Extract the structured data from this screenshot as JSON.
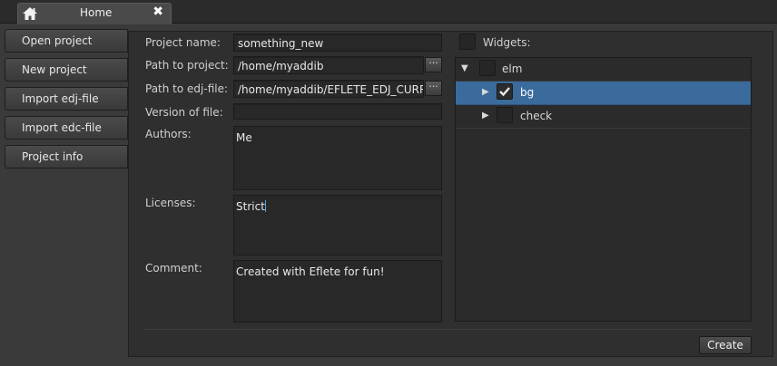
{
  "tabs": [
    {
      "label": "Home",
      "close": "✖"
    }
  ],
  "sidebar": {
    "items": [
      {
        "label": "Open project"
      },
      {
        "label": "New project"
      },
      {
        "label": "Import edj-file"
      },
      {
        "label": "Import edc-file"
      },
      {
        "label": "Project info"
      }
    ]
  },
  "form": {
    "project_name": {
      "label": "Project name:",
      "value": "something_new"
    },
    "path_to_project": {
      "label": "Path to project:",
      "value": "/home/myaddib",
      "browse": "···"
    },
    "path_to_edj": {
      "label": "Path to edj-file:",
      "value": "/home/myaddib/EFLETE_EDJ_CURRE",
      "browse": "···"
    },
    "version": {
      "label": "Version of file:",
      "value": ""
    },
    "authors": {
      "label": "Authors:",
      "value": "Me"
    },
    "licenses": {
      "label": "Licenses:",
      "value": "Strict"
    },
    "comment": {
      "label": "Comment:",
      "value": "Created with Eflete for fun!"
    }
  },
  "widgets": {
    "label": "Widgets:",
    "checked": false,
    "tree": [
      {
        "label": "elm",
        "expanded": true,
        "checked": false,
        "level": 0
      },
      {
        "label": "bg",
        "expanded": false,
        "checked": true,
        "selected": true,
        "level": 1
      },
      {
        "label": "check",
        "expanded": false,
        "checked": false,
        "level": 1
      }
    ]
  },
  "actions": {
    "create": "Create"
  },
  "colors": {
    "selection": "#3a6b9c",
    "background": "#3a3a3a",
    "panel": "#2f2f2f"
  }
}
